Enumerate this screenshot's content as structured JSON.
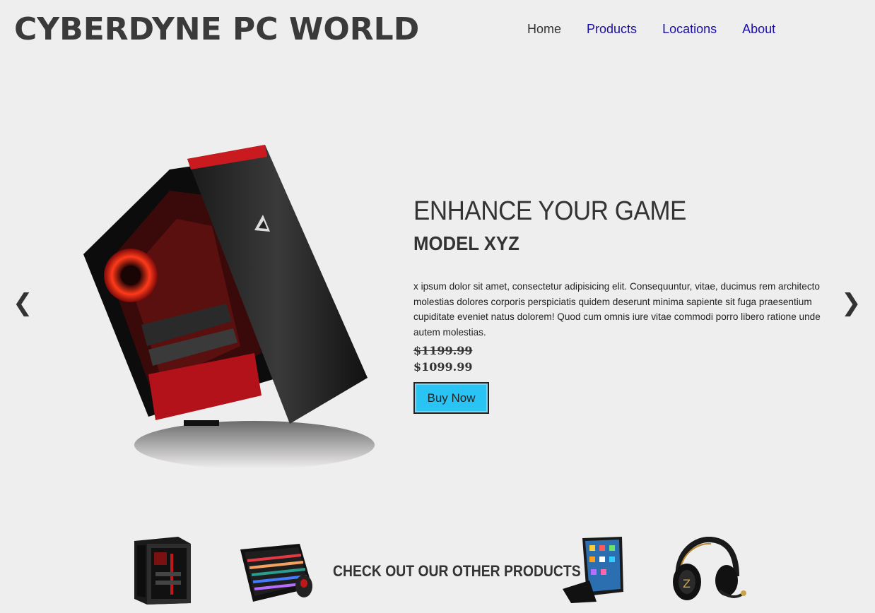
{
  "header": {
    "brand": "CYBERDYNE PC WORLD",
    "nav": [
      {
        "label": "Home"
      },
      {
        "label": "Products"
      },
      {
        "label": "Locations"
      },
      {
        "label": "About"
      }
    ]
  },
  "hero": {
    "prev_icon": "chevron-left-icon",
    "next_icon": "chevron-right-icon",
    "prev_glyph": "❮",
    "next_glyph": "❯",
    "title": "ENHANCE YOUR GAME",
    "model": "MODEL XYZ",
    "description": "x ipsum dolor sit amet, consectetur adipisicing elit. Consequuntur, vitae, ducimus rem architecto molestias dolores corporis perspiciatis quidem deserunt minima sapiente sit fuga praesentium cupiditate eveniet natus dolorem! Quod cum omnis iure vitae commodi porro libero ratione unde autem molestias.",
    "price_old": "$1199.99",
    "price_new": "$1099.99",
    "buy_label": "Buy Now",
    "accent": "#29c3f4"
  },
  "products": {
    "cta": "CHECK OUT OUR OTHER PRODUCTS"
  }
}
